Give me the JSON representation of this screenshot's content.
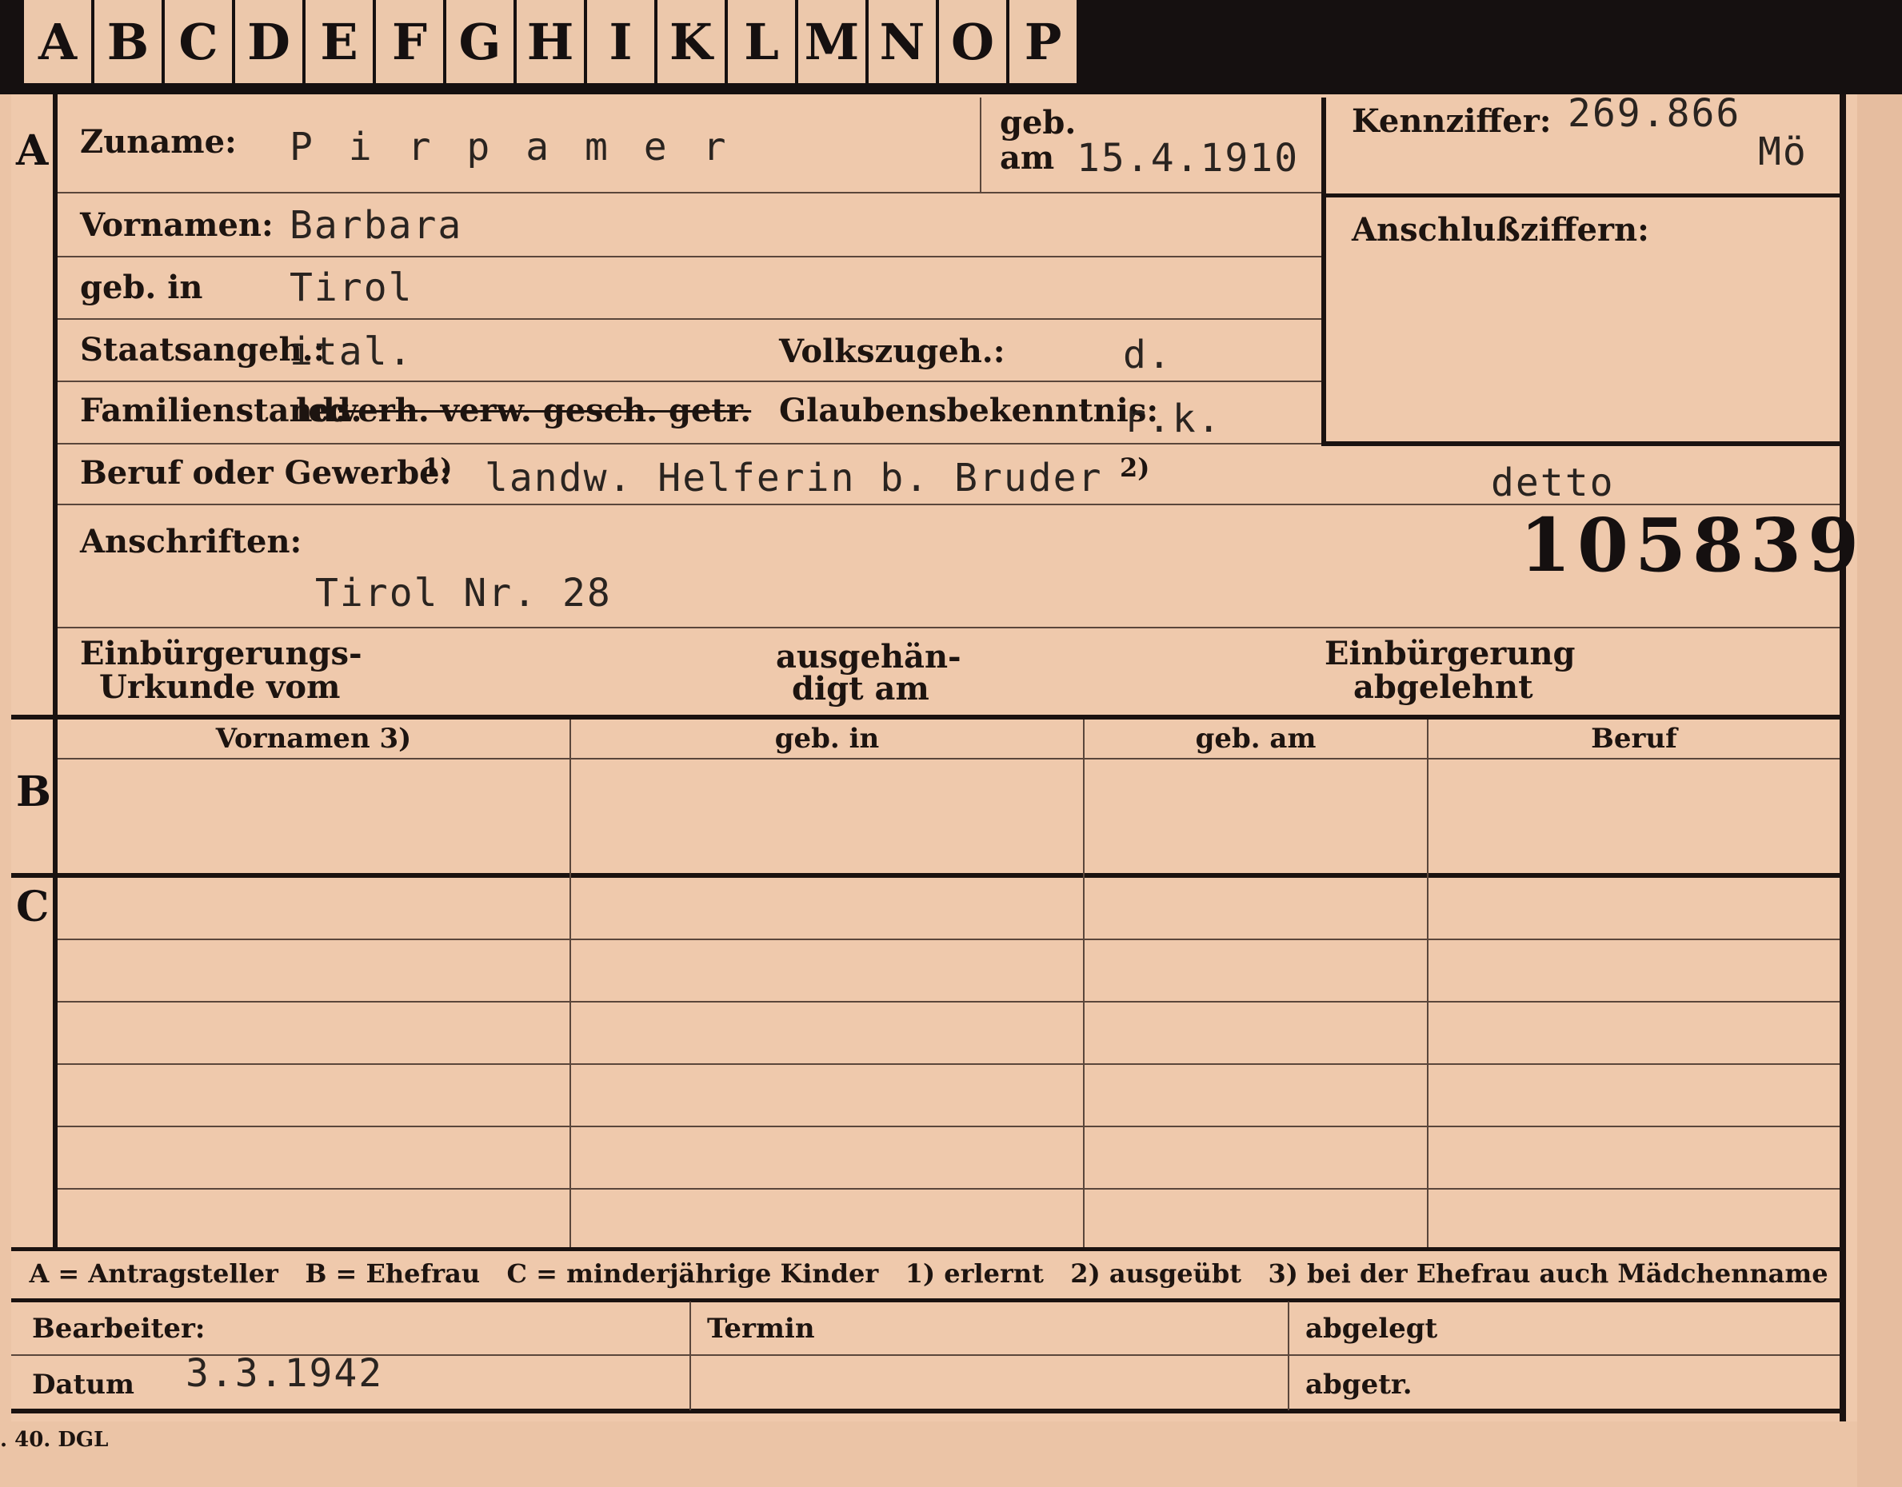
{
  "tabs": [
    "A",
    "B",
    "C",
    "D",
    "E",
    "F",
    "G",
    "H",
    "I",
    "K",
    "L",
    "M",
    "N",
    "O",
    "P"
  ],
  "section_a": {
    "letter": "A",
    "zuname_label": "Zuname:",
    "zuname_value": "P i r p a m e r",
    "geb_am_label_1": "geb.",
    "geb_am_label_2": "am",
    "geb_am_value": "15.4.1910",
    "kennziffer_label": "Kennziffer:",
    "kennziffer_value": "269.866",
    "kennziffer_suffix": "Mö",
    "anschluss_label": "Anschlußziffern:",
    "vornamen_label": "Vornamen:",
    "vornamen_value": "Barbara",
    "geb_in_label": "geb. in",
    "geb_in_value": "Tirol",
    "staats_label": "Staatsangeh.:",
    "staats_value": "ital.",
    "volks_label": "Volkszugeh.:",
    "volks_value": "d.",
    "familien_label": "Familienstand:",
    "familien_selected": "led.",
    "familien_struck": "verh. verw. gesch. getr.",
    "glaubens_label": "Glaubensbekenntnis:",
    "glaubens_value": "r.k.",
    "beruf_label": "Beruf oder Gewerbe:",
    "beruf_note1": "1)",
    "beruf_value": "landw. Helferin b. Bruder",
    "beruf_note2": "2)",
    "beruf_value2": "detto",
    "anschriften_label": "Anschriften:",
    "anschriften_value": "Tirol Nr. 28",
    "stamp_number": "105839",
    "einb_urkunde_1": "Einbürgerungs-",
    "einb_urkunde_2": "Urkunde vom",
    "ausgeh_1": "ausgehän-",
    "ausgeh_2": "digt am",
    "einb_abgel_1": "Einbürgerung",
    "einb_abgel_2": "abgelehnt"
  },
  "section_b": {
    "letter": "B",
    "headers": [
      "Vornamen 3)",
      "geb. in",
      "geb. am",
      "Beruf"
    ]
  },
  "section_c": {
    "letter": "C"
  },
  "legend": "A = Antragsteller   B = Ehefrau   C = minderjährige Kinder   1) erlernt   2) ausgeübt   3) bei der Ehefrau auch Mädchenname",
  "footer": {
    "bearbeiter_label": "Bearbeiter:",
    "datum_label": "Datum",
    "datum_value": "3.3.1942",
    "termin_label": "Termin",
    "abgelegt_label": "abgelegt",
    "abgetr_label": "abgetr."
  },
  "print_mark": ". 40. DGL"
}
